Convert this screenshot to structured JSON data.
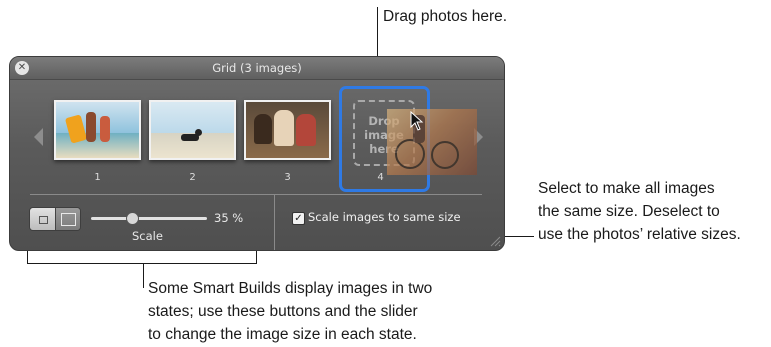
{
  "callouts": {
    "drag": "Drag photos here.",
    "scale_same": [
      "Select to make all images",
      "the same size. Deselect to",
      "use the photos’ relative sizes."
    ],
    "smart_builds": [
      "Some Smart Builds display images in two",
      "states; use these buttons and the slider",
      "to change the image size in each state."
    ]
  },
  "panel": {
    "title": "Grid (3 images)",
    "close_icon": "close-icon",
    "thumbnails": [
      {
        "number": "1",
        "subject": "people on beach with surfboard"
      },
      {
        "number": "2",
        "subject": "dog on beach"
      },
      {
        "number": "3",
        "subject": "group portrait"
      },
      {
        "number": "4"
      }
    ],
    "drop_placeholder": "Drop\nimage\nhere",
    "slider": {
      "value": 35,
      "value_label": "35 %",
      "label": "Scale"
    },
    "scale_checkbox": {
      "label": "Scale images to same size",
      "checked": true
    },
    "colors": {
      "panel_bg": "#5b5b5b",
      "selection": "#2f7ae5"
    }
  }
}
